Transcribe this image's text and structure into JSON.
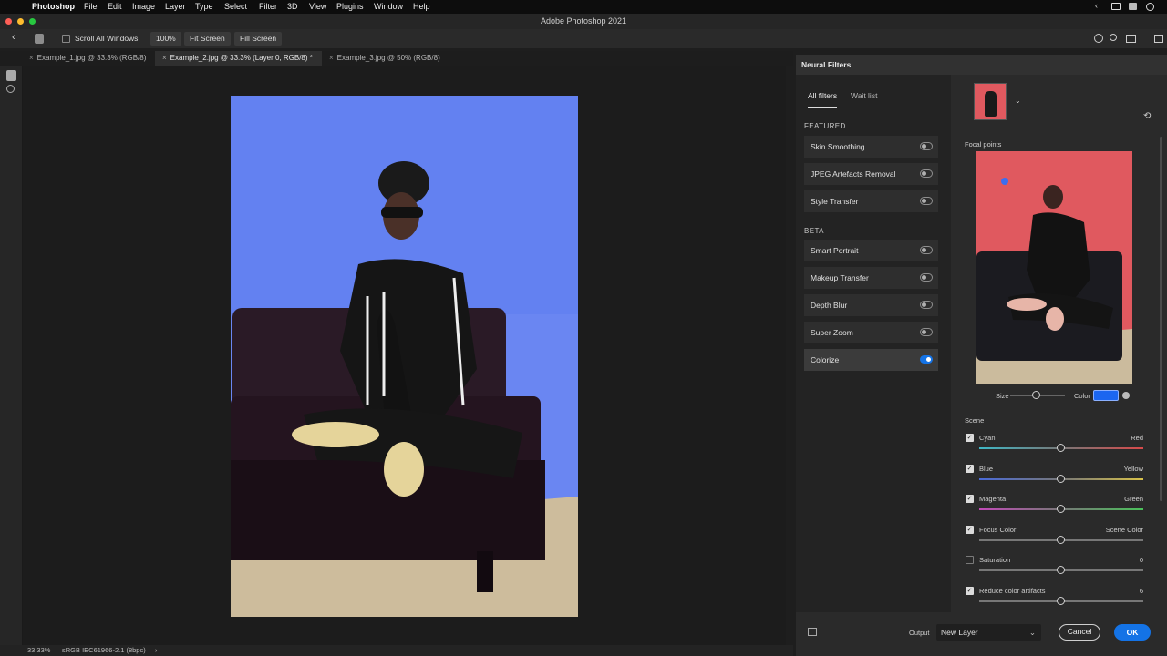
{
  "menubar": {
    "app": "Photoshop",
    "items": [
      "File",
      "Edit",
      "Image",
      "Layer",
      "Type",
      "Select",
      "Filter",
      "3D",
      "View",
      "Plugins",
      "Window",
      "Help"
    ]
  },
  "window": {
    "title": "Adobe Photoshop 2021"
  },
  "options": {
    "scroll_all": "Scroll All Windows",
    "zoom": "100%",
    "fit_screen": "Fit Screen",
    "fill_screen": "Fill Screen"
  },
  "tabs": [
    {
      "label": "Example_1.jpg @ 33.3% (RGB/8)"
    },
    {
      "label": "Example_2.jpg @ 33.3% (Layer 0, RGB/8) *"
    },
    {
      "label": "Example_3.jpg @ 50% (RGB/8)"
    }
  ],
  "status": {
    "zoom": "33.33%",
    "profile": "sRGB IEC61966-2.1 (8bpc)"
  },
  "panel": {
    "title": "Neural Filters",
    "tab_all": "All filters",
    "tab_wait": "Wait list",
    "featured": "FEATURED",
    "beta": "BETA",
    "featured_filters": [
      {
        "label": "Skin Smoothing",
        "on": false
      },
      {
        "label": "JPEG Artefacts Removal",
        "on": false
      },
      {
        "label": "Style Transfer",
        "on": false
      }
    ],
    "beta_filters": [
      {
        "label": "Smart Portrait",
        "on": false
      },
      {
        "label": "Makeup Transfer",
        "on": false
      },
      {
        "label": "Depth Blur",
        "on": false
      },
      {
        "label": "Super Zoom",
        "on": false
      },
      {
        "label": "Colorize",
        "on": true
      }
    ],
    "focal_points": "Focal points",
    "size_label": "Size",
    "color_label": "Color",
    "scene_label": "Scene",
    "sliders": [
      {
        "left": "Cyan",
        "right": "Red",
        "checked": true,
        "value": 0.5
      },
      {
        "left": "Blue",
        "right": "Yellow",
        "checked": true,
        "value": 0.5
      },
      {
        "left": "Magenta",
        "right": "Green",
        "checked": true,
        "value": 0.5
      },
      {
        "left": "Focus Color",
        "right": "Scene Color",
        "checked": true,
        "value": 0.5
      },
      {
        "left": "Saturation",
        "right": "0",
        "checked": false,
        "value": 0.5
      },
      {
        "left": "Reduce color artifacts",
        "right": "6",
        "checked": true,
        "value": 0.5
      }
    ],
    "output_label": "Output",
    "output_value": "New Layer",
    "cancel": "Cancel",
    "ok": "OK"
  },
  "colors": {
    "accent": "#1473e6",
    "canvas_blue": "#6a86f2",
    "preview_red": "#e0595f"
  }
}
